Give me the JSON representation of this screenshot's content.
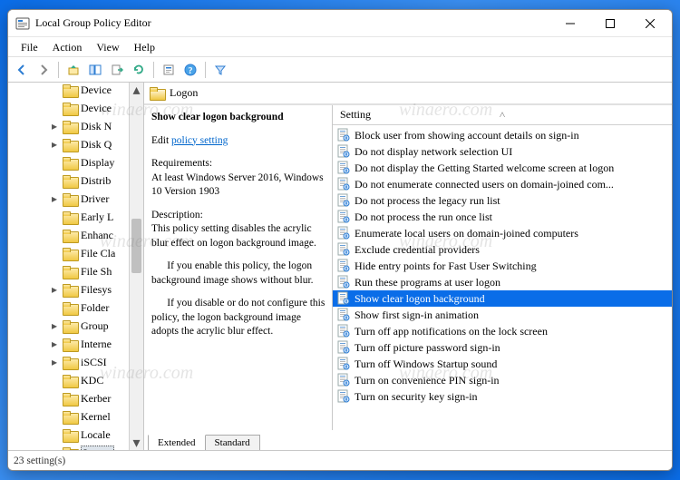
{
  "window": {
    "title": "Local Group Policy Editor",
    "icon": "gpedit-icon"
  },
  "menubar": [
    "File",
    "Action",
    "View",
    "Help"
  ],
  "toolbar_icons": [
    "back",
    "forward",
    "up",
    "show-hide-tree",
    "export",
    "refresh",
    "properties",
    "help",
    "filter"
  ],
  "tree": {
    "items": [
      {
        "label": "Device",
        "expander": ""
      },
      {
        "label": "Device",
        "expander": ""
      },
      {
        "label": "Disk N",
        "expander": ">"
      },
      {
        "label": "Disk Q",
        "expander": ">"
      },
      {
        "label": "Display",
        "expander": ""
      },
      {
        "label": "Distrib",
        "expander": ""
      },
      {
        "label": "Driver",
        "expander": ">"
      },
      {
        "label": "Early L",
        "expander": ""
      },
      {
        "label": "Enhanc",
        "expander": ""
      },
      {
        "label": "File Cla",
        "expander": ""
      },
      {
        "label": "File Sh",
        "expander": ""
      },
      {
        "label": "Filesys",
        "expander": ">"
      },
      {
        "label": "Folder",
        "expander": ""
      },
      {
        "label": "Group",
        "expander": ">"
      },
      {
        "label": "Interne",
        "expander": ">"
      },
      {
        "label": "iSCSI",
        "expander": ">"
      },
      {
        "label": "KDC",
        "expander": ""
      },
      {
        "label": "Kerber",
        "expander": ""
      },
      {
        "label": "Kernel",
        "expander": ""
      },
      {
        "label": "Locale",
        "expander": ""
      },
      {
        "label": "Logon",
        "expander": "",
        "selected": true
      }
    ]
  },
  "scope_header": "Logon",
  "description": {
    "policy_name": "Show clear logon background",
    "edit_prefix": "Edit ",
    "edit_link": "policy setting",
    "req_label": "Requirements:",
    "req_text": "At least Windows Server 2016, Windows 10 Version 1903",
    "desc_label": "Description:",
    "desc_text": "This policy setting disables the acrylic blur effect on logon background image.",
    "enable_text": "      If you enable this policy, the logon background image shows without blur.",
    "disable_text": "      If you disable or do not configure this policy, the logon background image adopts the acrylic blur effect."
  },
  "settings": {
    "column": "Setting",
    "items": [
      "Block user from showing account details on sign-in",
      "Do not display network selection UI",
      "Do not display the Getting Started welcome screen at logon",
      "Do not enumerate connected users on domain-joined com...",
      "Do not process the legacy run list",
      "Do not process the run once list",
      "Enumerate local users on domain-joined computers",
      "Exclude credential providers",
      "Hide entry points for Fast User Switching",
      "Run these programs at user logon",
      "Show clear logon background",
      "Show first sign-in animation",
      "Turn off app notifications on the lock screen",
      "Turn off picture password sign-in",
      "Turn off Windows Startup sound",
      "Turn on convenience PIN sign-in",
      "Turn on security key sign-in"
    ],
    "selected_index": 10
  },
  "tabs": {
    "extended": "Extended",
    "standard": "Standard",
    "active": "Extended"
  },
  "statusbar": "23 setting(s)",
  "watermark": "winaero.com"
}
